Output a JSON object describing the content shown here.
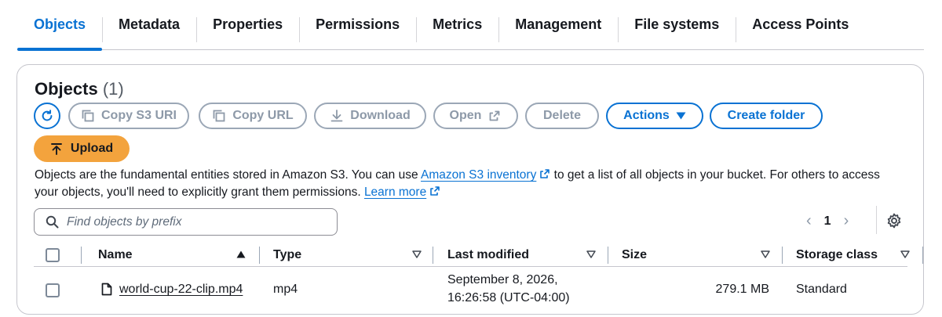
{
  "tabs": [
    {
      "label": "Objects"
    },
    {
      "label": "Metadata"
    },
    {
      "label": "Properties"
    },
    {
      "label": "Permissions"
    },
    {
      "label": "Metrics"
    },
    {
      "label": "Management"
    },
    {
      "label": "File systems"
    },
    {
      "label": "Access Points"
    }
  ],
  "objects_panel": {
    "title": "Objects",
    "count": "(1)",
    "buttons": {
      "copy_s3_uri": "Copy S3 URI",
      "copy_url": "Copy URL",
      "download": "Download",
      "open": "Open",
      "delete": "Delete",
      "actions": "Actions",
      "create_folder": "Create folder",
      "upload": "Upload"
    },
    "description": {
      "part1": "Objects are the fundamental entities stored in Amazon S3. You can use ",
      "inventory_link": "Amazon S3 inventory",
      "part2": " to get a list of all objects in your bucket. For others to access your objects, you'll need to explicitly grant them permissions. ",
      "learn_more": "Learn more"
    },
    "search": {
      "placeholder": "Find objects by prefix",
      "value": ""
    },
    "pagination": {
      "current_page": "1"
    },
    "table": {
      "columns": [
        "Name",
        "Type",
        "Last modified",
        "Size",
        "Storage class"
      ],
      "rows": [
        {
          "name": "world-cup-22-clip.mp4",
          "type": "mp4",
          "last_modified_line1": "September 8, 2026,",
          "last_modified_line2": "16:26:58 (UTC-04:00)",
          "size": "279.1 MB",
          "storage_class": "Standard"
        }
      ]
    }
  },
  "colors": {
    "accent": "#0972d3",
    "upload_button": "#f3a33d",
    "disabled_text": "#8d99a8",
    "text": "#16191f"
  },
  "icons": [
    "refresh-icon",
    "copy-icon",
    "download-icon",
    "external-link-icon",
    "caret-down-icon",
    "upload-arrow-icon",
    "search-icon",
    "chevron-left-icon",
    "chevron-right-icon",
    "gear-icon",
    "file-icon",
    "sort-ascending-icon",
    "sort-icon"
  ]
}
